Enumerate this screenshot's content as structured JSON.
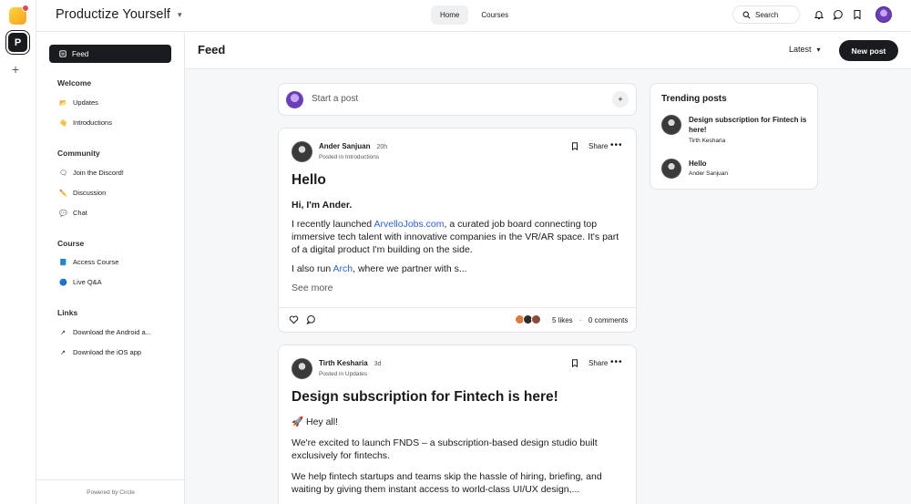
{
  "brand": {
    "name": "Productize Yourself"
  },
  "nav": {
    "tabs": [
      "Home",
      "Courses"
    ]
  },
  "search": {
    "label": "Search"
  },
  "sidebar": {
    "feed_label": "Feed",
    "sections": [
      {
        "title": "Welcome",
        "items": [
          {
            "icon": "📂",
            "label": "Updates"
          },
          {
            "icon": "👋",
            "label": "Introductions"
          }
        ]
      },
      {
        "title": "Community",
        "items": [
          {
            "icon": "🗨",
            "label": "Join the Discord!"
          },
          {
            "icon": "✏️",
            "label": "Discussion"
          },
          {
            "icon": "💬",
            "label": "Chat"
          }
        ]
      },
      {
        "title": "Course",
        "items": [
          {
            "icon": "📘",
            "label": "Access Course"
          },
          {
            "icon": "🔵",
            "label": "Live Q&A"
          }
        ]
      },
      {
        "title": "Links",
        "items": [
          {
            "icon": "↗",
            "label": "Download the Android a..."
          },
          {
            "icon": "↗",
            "label": "Download the iOS app"
          }
        ]
      }
    ],
    "powered_by": "Powered by Circle"
  },
  "feed": {
    "title": "Feed",
    "sort_label": "Latest",
    "new_post_label": "New post",
    "start_post_placeholder": "Start a post"
  },
  "posts": [
    {
      "author": "Ander Sanjuan",
      "time": "20h",
      "posted_in_prefix": "Posted in",
      "posted_in": "Introductions",
      "share_label": "Share",
      "title": "Hello",
      "greeting": "Hi, I'm Ander.",
      "p1_before": "I recently launched ",
      "p1_link": "ArvelloJobs.com",
      "p1_after": ", a curated job board connecting top immersive tech talent with innovative companies in the VR/AR space. It's part of a digital product I'm building on the side.",
      "p2_before": "I also run ",
      "p2_link": "Arch",
      "p2_after": ", where we partner with s...",
      "see_more": "See more",
      "likes": "5 likes",
      "separator": "·",
      "comments": "0 comments"
    },
    {
      "author": "Tirth Kesharia",
      "time": "3d",
      "posted_in_prefix": "Posted in",
      "posted_in": "Updates",
      "share_label": "Share",
      "title": "Design subscription for Fintech is here!",
      "p0": "🚀 Hey all!",
      "p1": "We're excited to launch FNDS – a subscription-based design studio built exclusively for fintechs.",
      "p2": "We help fintech startups and teams skip the hassle of hiring, briefing, and waiting by giving them instant access to world-class UI/UX design,..."
    }
  ],
  "trending": {
    "title": "Trending posts",
    "items": [
      {
        "title": "Design subscription for Fintech is here!",
        "author": "Tirth Kesharia"
      },
      {
        "title": "Hello",
        "author": "Ander Sanjuan"
      }
    ]
  },
  "colors": {
    "accent": "#191b1f",
    "link": "#2a62d6",
    "background": "#f6f7f9"
  }
}
